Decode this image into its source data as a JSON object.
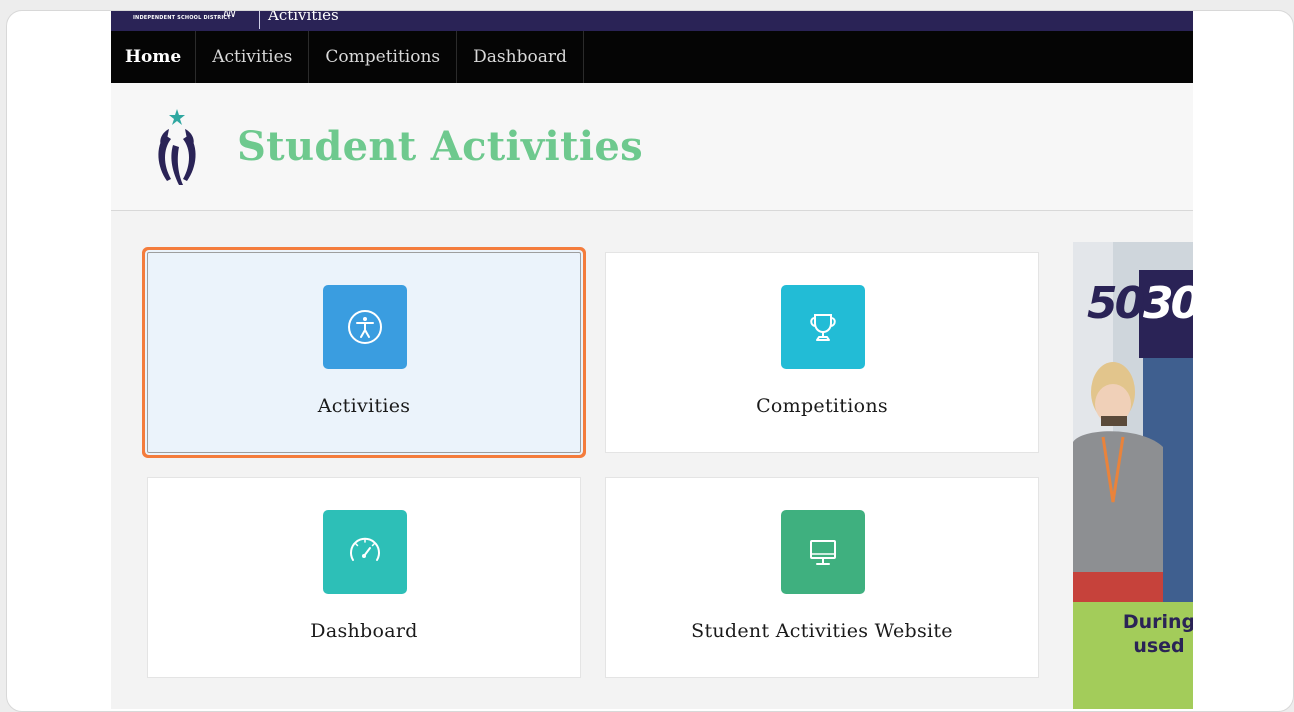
{
  "district_bar": {
    "district_name": "INDEPENDENT SCHOOL DISTRICT",
    "app_name": "Activities"
  },
  "nav": {
    "items": [
      {
        "label": "Home",
        "active": true
      },
      {
        "label": "Activities",
        "active": false
      },
      {
        "label": "Competitions",
        "active": false
      },
      {
        "label": "Dashboard",
        "active": false
      }
    ]
  },
  "header": {
    "title": "Student Activities"
  },
  "tiles": [
    {
      "label": "Activities",
      "icon": "accessibility-icon",
      "color": "#3a9de0",
      "selected": true
    },
    {
      "label": "Competitions",
      "icon": "trophy-icon",
      "color": "#22bcd6",
      "selected": false
    },
    {
      "label": "Dashboard",
      "icon": "speedometer-icon",
      "color": "#2dbfb7",
      "selected": false
    },
    {
      "label": "Student Activities Website",
      "icon": "monitor-icon",
      "color": "#3fb07f",
      "selected": false
    }
  ],
  "ad": {
    "logo_text_a": "50",
    "logo_text_b": "30",
    "band_text": "During used"
  },
  "colors": {
    "nav_bg": "#050505",
    "district_bar_bg": "#2a2356",
    "title": "#6ec98e",
    "selection_outline": "#f47c3c"
  }
}
